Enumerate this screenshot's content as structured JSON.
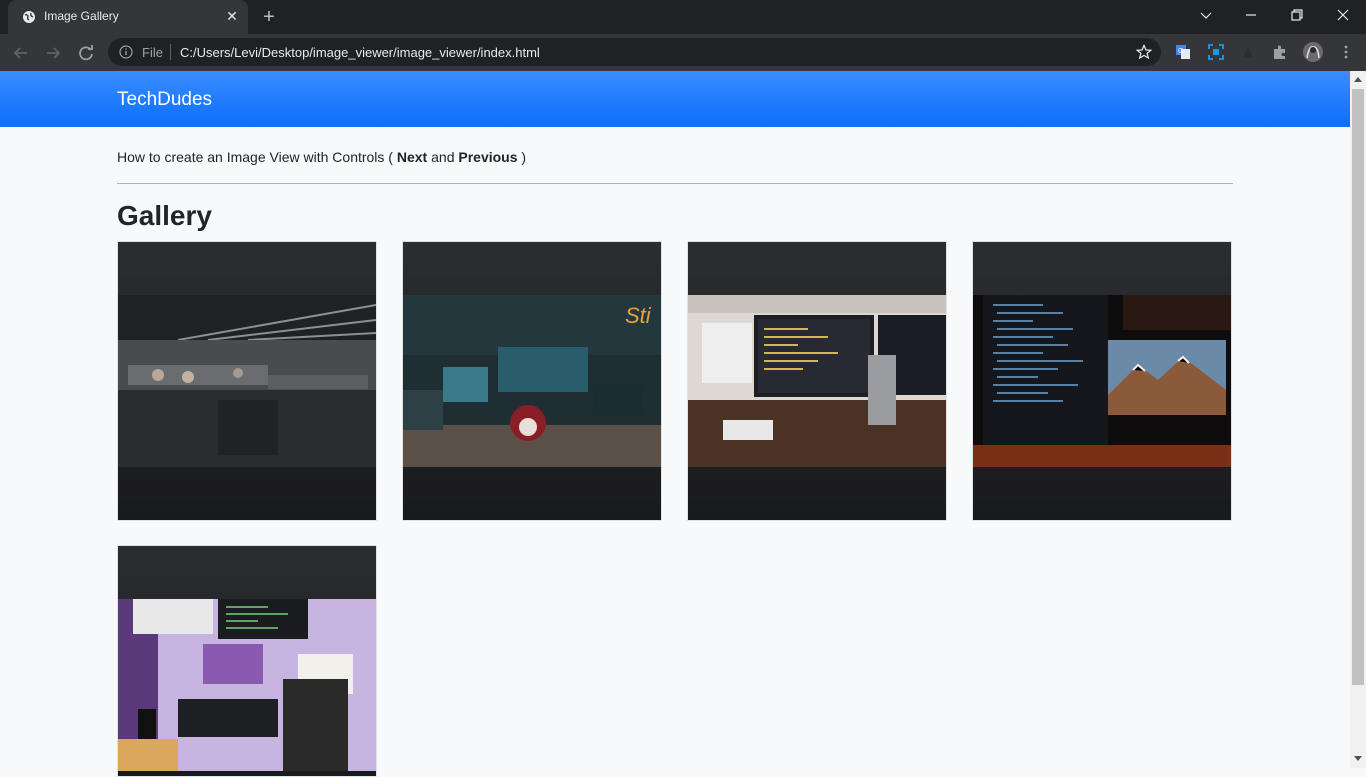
{
  "browser": {
    "tab_title": "Image Gallery",
    "address_scheme": "File",
    "url": "C:/Users/Levi/Desktop/image_viewer/image_viewer/index.html"
  },
  "navbar": {
    "brand": "TechDudes"
  },
  "intro": {
    "prefix": "How to create an Image View with Controls ( ",
    "next": "Next",
    "and": " and ",
    "previous": "Previous",
    "suffix": " )"
  },
  "gallery": {
    "title": "Gallery",
    "images": [
      {
        "icon": "office-workspace-photo"
      },
      {
        "icon": "hacker-desk-photo"
      },
      {
        "icon": "dual-monitor-desk-photo"
      },
      {
        "icon": "code-monitor-mountain-photo"
      },
      {
        "icon": "topdown-desk-photo"
      }
    ]
  },
  "colors": {
    "navbar": "#0d6efd",
    "page_bg": "#f8f9fa",
    "card_bg": "#212529"
  }
}
